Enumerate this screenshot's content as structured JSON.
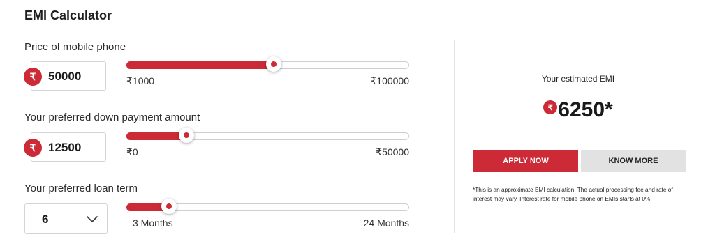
{
  "title": "EMI Calculator",
  "currency_symbol": "₹",
  "accent_color": "#cc2a36",
  "price": {
    "label": "Price of mobile phone",
    "value": "50000",
    "min_label": "₹1000",
    "max_label": "₹100000",
    "slider_fraction": 0.52
  },
  "down_payment": {
    "label": "Your preferred down payment amount",
    "value": "12500",
    "min_label": "₹0",
    "max_label": "₹50000",
    "slider_fraction": 0.21
  },
  "loan_term": {
    "label": "Your preferred loan term",
    "selected": "6",
    "min_label": "3 Months",
    "max_label": "24 Months",
    "slider_fraction": 0.15
  },
  "result": {
    "caption": "Your estimated EMI",
    "value": "6250*",
    "apply_label": "APPLY NOW",
    "know_label": "KNOW MORE",
    "disclaimer": "*This is an approximate EMI calculation. The actual processing fee and rate of interest may vary. Interest rate for mobile phone on EMIs starts at 0%."
  }
}
